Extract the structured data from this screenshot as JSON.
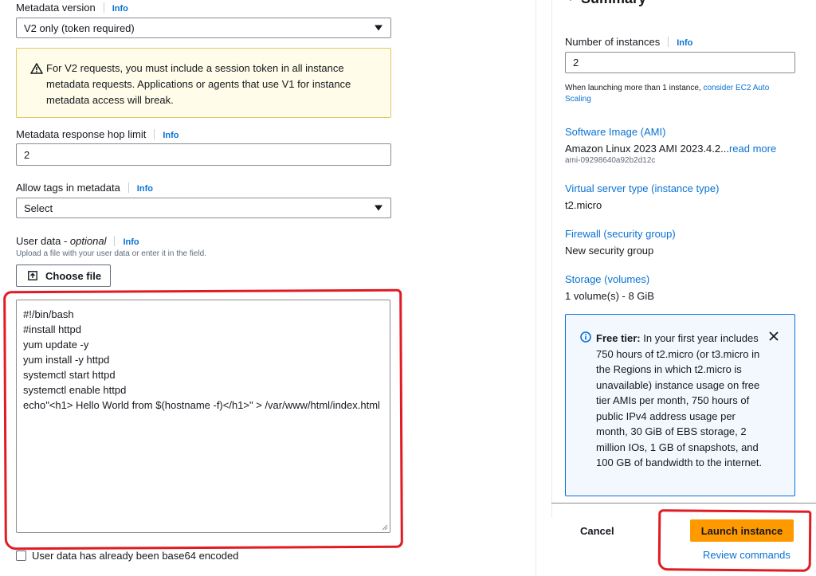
{
  "left": {
    "metadata_version": {
      "label": "Metadata version",
      "info": "Info",
      "value": "V2 only (token required)"
    },
    "warning": {
      "text": "For V2 requests, you must include a session token in all instance metadata requests. Applications or agents that use V1 for instance metadata access will break."
    },
    "hop_limit": {
      "label": "Metadata response hop limit",
      "info": "Info",
      "value": "2"
    },
    "allow_tags": {
      "label": "Allow tags in metadata",
      "info": "Info",
      "value": "Select"
    },
    "user_data": {
      "label": "User data - ",
      "label_optional": "optional",
      "info": "Info",
      "description": "Upload a file with your user data or enter it in the field.",
      "choose_file": "Choose file",
      "lines": [
        "#!/bin/bash",
        "#install httpd",
        "yum update -y",
        "yum install -y httpd",
        "systemctl start httpd",
        "systemctl enable httpd",
        "echo\"<h1> Hello World from $(hostname -f)</h1>\" > /var/www/html/index.html"
      ],
      "base64_checkbox": "User data has already been base64 encoded"
    }
  },
  "summary": {
    "title": "Summary",
    "instances_label": "Number of instances",
    "info": "Info",
    "instances_value": "2",
    "autoscale_prefix": "When launching more than 1 instance, ",
    "autoscale_link": "consider EC2 Auto Scaling",
    "ami_head": "Software Image (AMI)",
    "ami_value": "Amazon Linux 2023 AMI 2023.4.2...",
    "ami_more": "read more",
    "ami_id": "ami-09298640a92b2d12c",
    "type_head": "Virtual server type (instance type)",
    "type_value": "t2.micro",
    "firewall_head": "Firewall (security group)",
    "firewall_value": "New security group",
    "storage_head": "Storage (volumes)",
    "storage_value": "1 volume(s) - 8 GiB",
    "free_tier_bold": "Free tier:",
    "free_tier_text": " In your first year includes 750 hours of t2.micro (or t3.micro in the Regions in which t2.micro is unavailable) instance usage on free tier AMIs per month, 750 hours of public IPv4 address usage per month, 30 GiB of EBS storage, 2 million IOs, 1 GB of snapshots, and 100 GB of bandwidth to the internet.",
    "cancel": "Cancel",
    "launch": "Launch instance",
    "review": "Review commands"
  },
  "colors": {
    "accent": "#0972d3",
    "primary_button": "#ff9900",
    "annotation": "#e01b24",
    "warning_bg": "#fffce9"
  }
}
